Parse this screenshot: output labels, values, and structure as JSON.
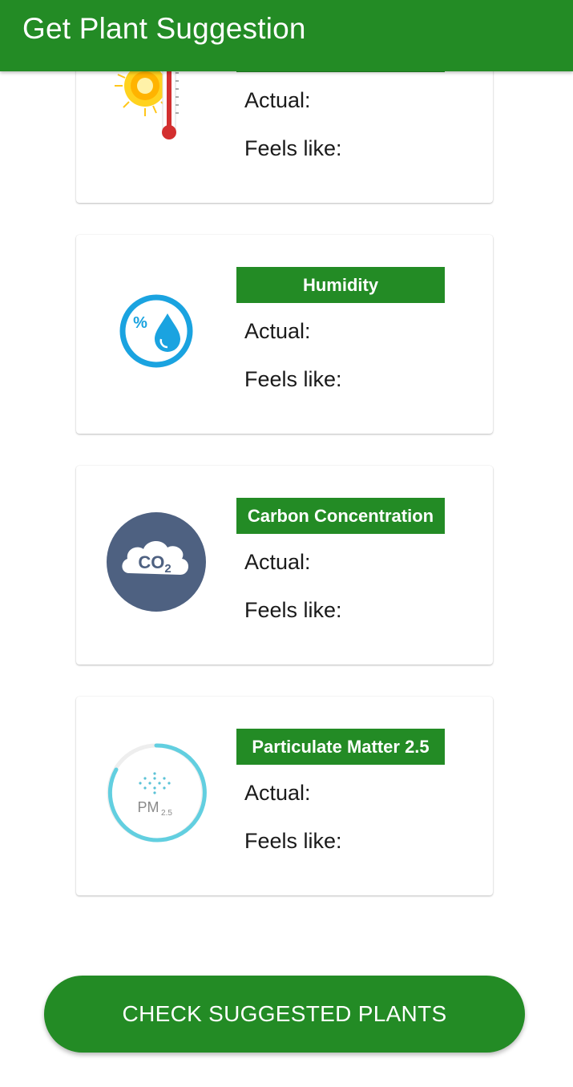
{
  "app_bar": {
    "title": "Get Plant Suggestion"
  },
  "cards": [
    {
      "title": "",
      "icon": "thermometer-sun-icon",
      "actual_label": "Actual:",
      "feels_label": "Feels like:"
    },
    {
      "title": "Humidity",
      "icon": "humidity-drop-icon",
      "actual_label": "Actual:",
      "feels_label": "Feels like:"
    },
    {
      "title": "Carbon Concentration",
      "icon": "co2-cloud-icon",
      "icon_text": "CO2",
      "actual_label": "Actual:",
      "feels_label": "Feels like:"
    },
    {
      "title": "Particulate Matter 2.5",
      "icon": "pm25-icon",
      "icon_text": "PM",
      "icon_subtext": "2.5",
      "actual_label": "Actual:",
      "feels_label": "Feels like:"
    }
  ],
  "action": {
    "check_button_label": "CHECK SUGGESTED PLANTS"
  },
  "colors": {
    "primary_green": "#238b25",
    "humidity_blue": "#1aa3e0",
    "co2_slate": "#4e6181",
    "pm_cyan": "#62cfe0"
  }
}
